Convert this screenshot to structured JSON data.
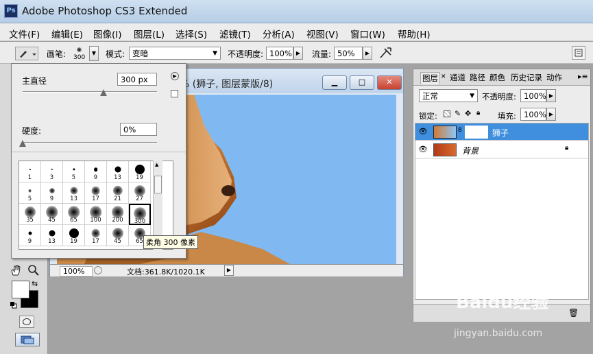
{
  "app": {
    "icon_text": "Ps",
    "title": "Adobe Photoshop CS3 Extended"
  },
  "menu": [
    "文件(F)",
    "编辑(E)",
    "图像(I)",
    "图层(L)",
    "选择(S)",
    "滤镜(T)",
    "分析(A)",
    "视图(V)",
    "窗口(W)",
    "帮助(H)"
  ],
  "options": {
    "brush_label": "画笔:",
    "brush_size": "300",
    "mode_label": "模式:",
    "mode_value": "变暗",
    "opacity_label": "不透明度:",
    "opacity_value": "100%",
    "flow_label": "流量:",
    "flow_value": "50%"
  },
  "brush_popup": {
    "diameter_label": "主直径",
    "diameter_value": "300 px",
    "diameter_fraction": 0.6,
    "hardness_label": "硬度:",
    "hardness_value": "0%",
    "hardness_fraction": 0.0,
    "presets": [
      {
        "label": "1",
        "kind": "hard",
        "r": 1
      },
      {
        "label": "3",
        "kind": "hard",
        "r": 1.2
      },
      {
        "label": "5",
        "kind": "hard",
        "r": 1.6
      },
      {
        "label": "9",
        "kind": "hard",
        "r": 2.8
      },
      {
        "label": "13",
        "kind": "hard",
        "r": 4.5
      },
      {
        "label": "19",
        "kind": "hard",
        "r": 7
      },
      {
        "label": "5",
        "kind": "soft",
        "r": 1.5
      },
      {
        "label": "9",
        "kind": "soft",
        "r": 2.5
      },
      {
        "label": "13",
        "kind": "soft",
        "r": 3.5
      },
      {
        "label": "17",
        "kind": "soft",
        "r": 4
      },
      {
        "label": "21",
        "kind": "soft",
        "r": 4.5
      },
      {
        "label": "27",
        "kind": "soft",
        "r": 5
      },
      {
        "label": "35",
        "kind": "soft",
        "r": 5
      },
      {
        "label": "45",
        "kind": "soft",
        "r": 5.5
      },
      {
        "label": "65",
        "kind": "soft",
        "r": 5.5
      },
      {
        "label": "100",
        "kind": "soft",
        "r": 5.5
      },
      {
        "label": "200",
        "kind": "soft",
        "r": 5.5
      },
      {
        "label": "300",
        "kind": "soft",
        "r": 5.5,
        "selected": true
      },
      {
        "label": "9",
        "kind": "hard",
        "r": 2.5
      },
      {
        "label": "13",
        "kind": "hard",
        "r": 4.5
      },
      {
        "label": "19",
        "kind": "hard",
        "r": 7
      },
      {
        "label": "17",
        "kind": "soft",
        "r": 4
      },
      {
        "label": "45",
        "kind": "soft",
        "r": 5
      },
      {
        "label": "65",
        "kind": "soft",
        "r": 5
      }
    ],
    "tooltip": "柔角 300 像素"
  },
  "document": {
    "title": "% (狮子, 图层蒙版/8)",
    "zoom": "100%",
    "doc_info": "文档:361.8K/1020.1K"
  },
  "layers_panel": {
    "tabs": [
      "图层",
      "通道",
      "路径",
      "颜色",
      "历史记录",
      "动作"
    ],
    "blend_mode": "正常",
    "opacity_label": "不透明度:",
    "opacity_value": "100%",
    "lock_label": "锁定:",
    "fill_label": "填充:",
    "fill_value": "100%",
    "layers": [
      {
        "name": "狮子",
        "selected": true
      },
      {
        "name": "背景",
        "selected": false
      }
    ]
  },
  "watermark": {
    "brand": "Baidu经验",
    "url": "jingyan.baidu.com"
  },
  "colors": {
    "canvas_sky": "#80b9f2",
    "selected_layer": "#3f8fde",
    "close_button": "#c9412f"
  }
}
